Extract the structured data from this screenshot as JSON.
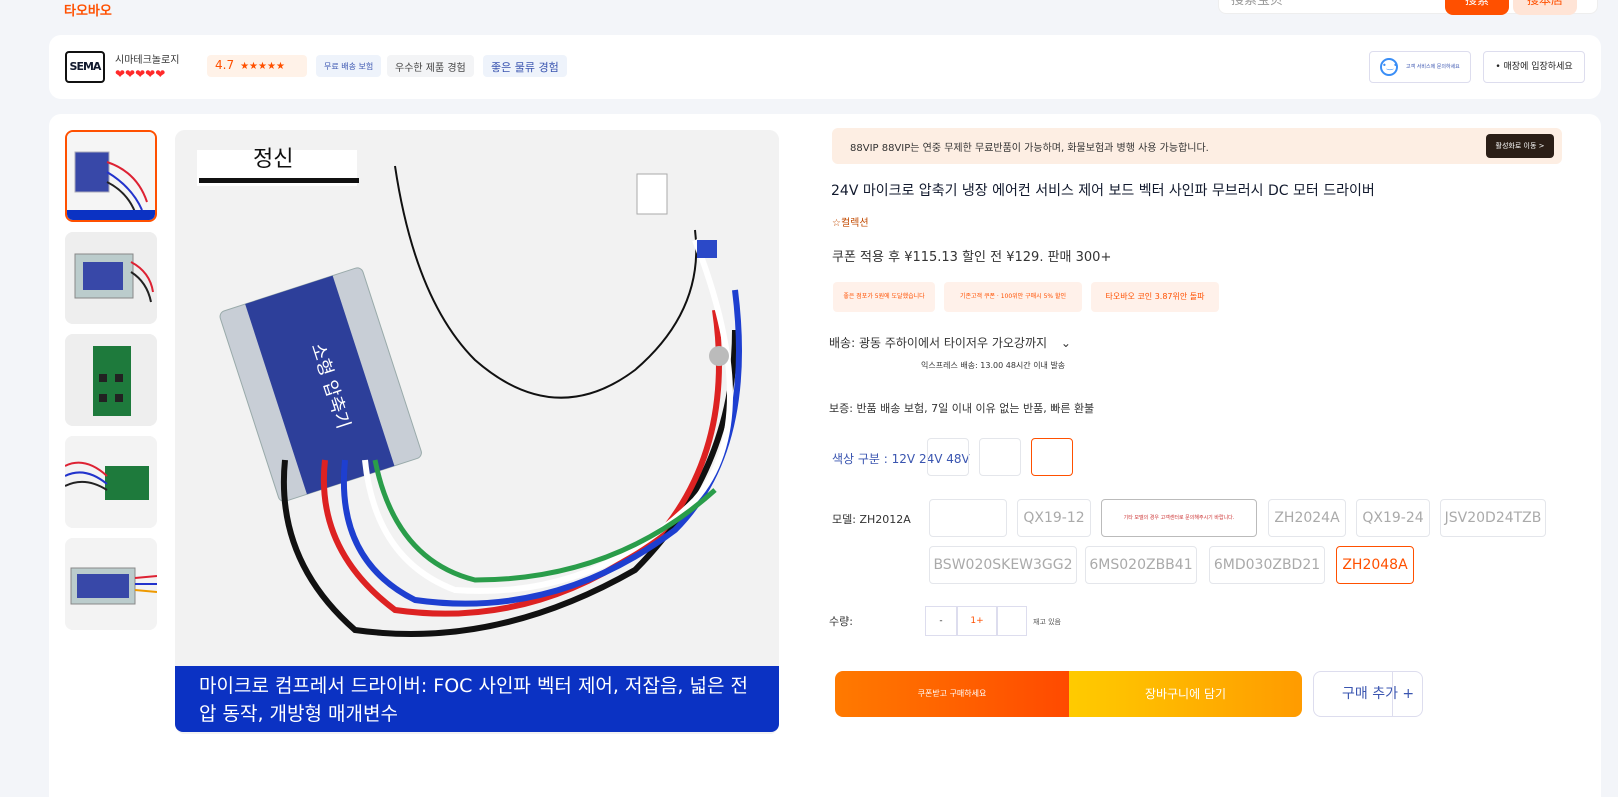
{
  "top": {
    "brand": "타오바오",
    "search_placeholder": "搜索宝贝",
    "search_btn": "搜索",
    "search_btn2": "搜本店"
  },
  "shop": {
    "logo": "SEMA",
    "name": "시마테크놀로지",
    "hearts": "❤❤❤❤❤",
    "rating": "4.7",
    "stars": "★★★★★",
    "tags": [
      "무료 배송 보험",
      "우수한 제품 경험",
      "좋은 물류 경험"
    ],
    "cs_label": "고객 서비스에 문의하세요",
    "enter": "• 매장에 입장하세요"
  },
  "gallery": {
    "badge": "정신",
    "caption": "마이크로 컴프레서 드라이버: FOC 사인파 벡터 제어, 저잡음, 넓은 전압 동작, 개방형 매개변수",
    "box_text": "소형 압축기"
  },
  "product": {
    "vip_text": "88VIP 88VIP는 연중 무제한 무료반품이 가능하며, 화물보험과 병행 사용 가능합니다.",
    "vip_go": "활성화로 이동 >",
    "title": "24V 마이크로 압축기 냉장 에어컨 서비스 제어 보드 벡터 사인파 무브러시 DC 모터 드라이버",
    "collect": "☆컬렉션",
    "price": "쿠폰 적용 후 ¥115.13 할인 전 ¥129. 판매 300+",
    "coupons": [
      "좋은 점포가 5원에 도달했습니다",
      "기존고객 쿠폰 · 100위안 구매시 5% 할인",
      "타오바오 코인 3.87위안 돌파"
    ],
    "ship": "배송: 광동 주하이에서 타이저우 가오강까지",
    "ship_detail": "익스프레스 배송: 13.00 48시간 이내 발송",
    "warranty": "보증: 반품 배송 보험, 7일 이내 이유 없는 반품, 빠른 환불",
    "color_label": "색상 구분 : 12V 24V 48V",
    "model_label": "모델: ZH2012A",
    "model_note": "기타 모델의 경우 고객센터로 문의해주시기 바랍니다.",
    "models": [
      "QX19-12",
      "ZH2024A",
      "QX19-24",
      "JSV20D24TZB",
      "BSW020SKEW3GG2",
      "6MS020ZBB41",
      "6MD030ZBD21",
      "ZH2048A"
    ],
    "qty_label": "수량:",
    "qty_minus": "-",
    "qty_value": "1+",
    "stock": "재고 있음",
    "buy_now": "쿠폰받고 구매하세요",
    "add_cart": "장바구니에 담기",
    "add_more": "구매 추가 +"
  },
  "colors": {
    "accent": "#ff5000",
    "blue": "#0b32c3"
  }
}
